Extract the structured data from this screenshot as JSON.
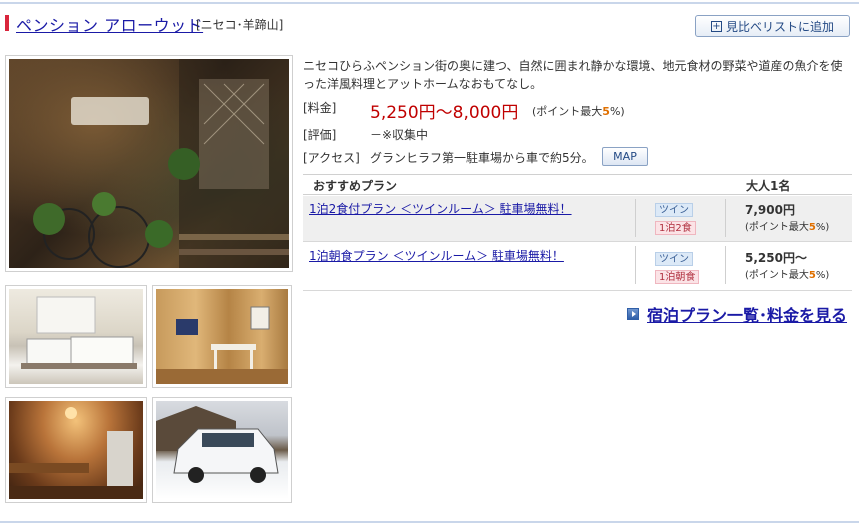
{
  "header": {
    "hotel_name": "ペンション アローウッド",
    "area": "[ニセコ･羊蹄山]",
    "compare_button": "見比べリストに追加"
  },
  "description": "ニセコひらふペンション街の奥に建つ、自然に囲まれ静かな環境、地元食材の野菜や道産の魚介を使った洋風料理とアットホームなおもてなし。",
  "details": {
    "price_label": "[料金]",
    "price_value": "5,250円〜8,000円",
    "price_note_prefix": "(ポイント最大",
    "price_note_pct": "5",
    "price_note_suffix": "%)",
    "rating_label": "[評価]",
    "rating_value": "－※収集中",
    "access_label": "[アクセス]",
    "access_value": "グランヒラフ第一駐車場から車で約5分。",
    "map_button": "MAP"
  },
  "plans": {
    "header_plan": "おすすめプラン",
    "header_price": "大人1名",
    "rows": [
      {
        "name": "1泊2食付プラン ＜ツインルーム＞ 駐車場無料！",
        "room_tag": "ツイン",
        "meal_tag": "1泊2食",
        "price": "7,900円",
        "point_prefix": "(ポイント最大",
        "point_pct": "5",
        "point_suffix": "%)"
      },
      {
        "name": "1泊朝食プラン ＜ツインルーム＞ 駐車場無料！",
        "room_tag": "ツイン",
        "meal_tag": "1泊朝食",
        "price": "5,250円〜",
        "point_prefix": "(ポイント最大",
        "point_pct": "5",
        "point_suffix": "%)"
      }
    ]
  },
  "see_all_link": "宿泊プラン一覧･料金を見る"
}
